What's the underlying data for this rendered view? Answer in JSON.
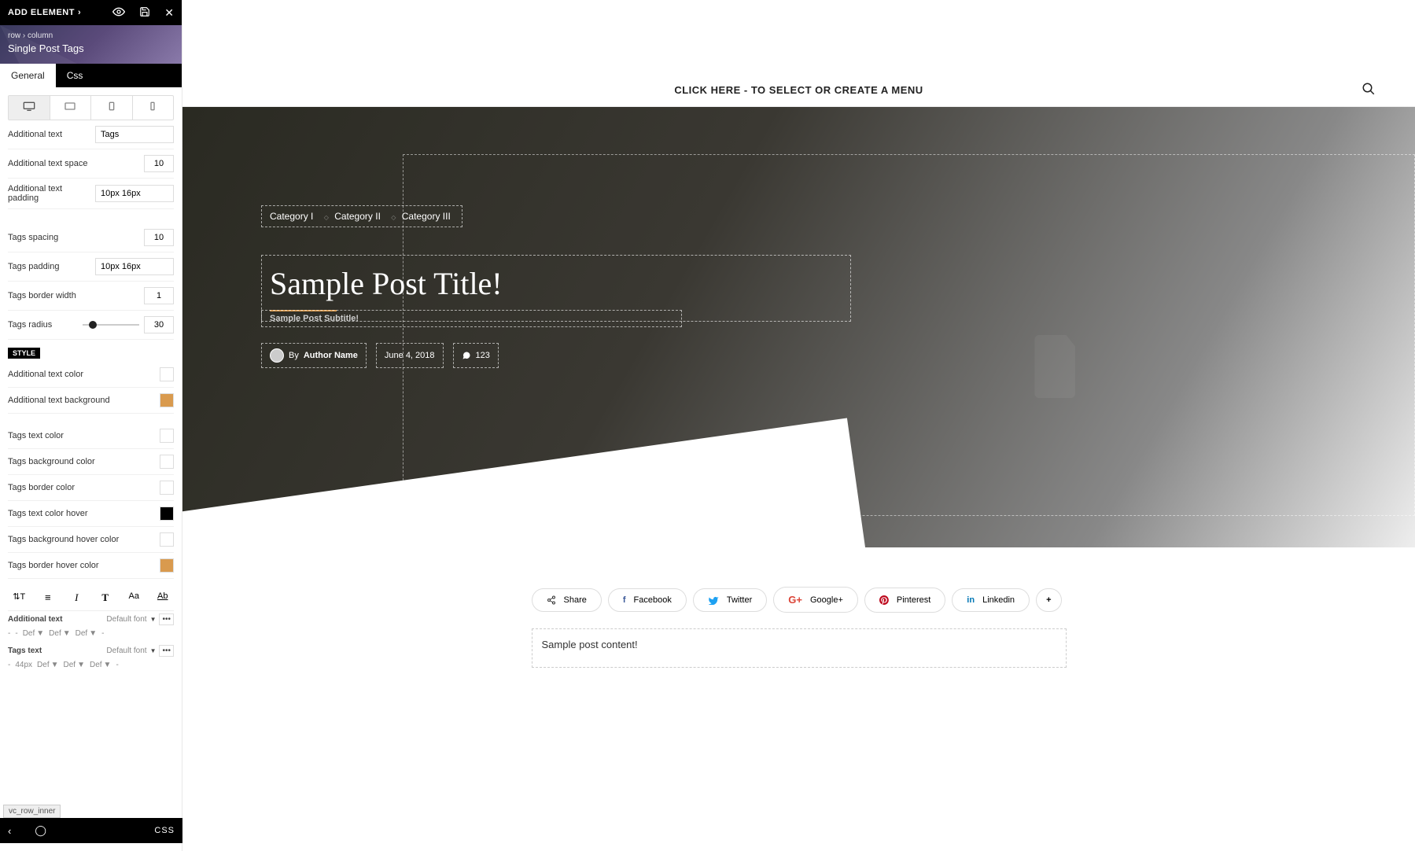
{
  "sidebar": {
    "add_element": "ADD ELEMENT",
    "breadcrumb": "row › column",
    "title": "Single Post Tags",
    "tabs": {
      "general": "General",
      "css": "Css"
    },
    "fields": {
      "additional_text": {
        "label": "Additional text",
        "value": "Tags"
      },
      "additional_text_space": {
        "label": "Additional text space",
        "value": "10"
      },
      "additional_text_padding": {
        "label": "Additional text padding",
        "value": "10px 16px"
      },
      "tags_spacing": {
        "label": "Tags spacing",
        "value": "10"
      },
      "tags_padding": {
        "label": "Tags padding",
        "value": "10px 16px"
      },
      "tags_border_width": {
        "label": "Tags border width",
        "value": "1"
      },
      "tags_radius": {
        "label": "Tags radius",
        "value": "30"
      }
    },
    "style_label": "STYLE",
    "colors": {
      "additional_text_color": "Additional text color",
      "additional_text_background": "Additional text background",
      "tags_text_color": "Tags text color",
      "tags_background_color": "Tags background color",
      "tags_border_color": "Tags border color",
      "tags_text_color_hover": "Tags text color hover",
      "tags_background_hover_color": "Tags background hover color",
      "tags_border_hover_color": "Tags border hover color"
    },
    "color_values": {
      "additional_text_background": "#d99a4e",
      "tags_text_color_hover": "#000000",
      "tags_border_hover_color": "#d99a4e"
    },
    "typo": {
      "additional_text_label": "Additional text",
      "tags_text_label": "Tags text",
      "default_font": "Default font",
      "def": "Def",
      "px44": "44px",
      "dash": "-"
    },
    "vc_row": "vc_row_inner",
    "bottom_css": "CSS"
  },
  "preview": {
    "menu_text": "CLICK HERE - TO SELECT OR CREATE A MENU",
    "categories": [
      "Category I",
      "Category II",
      "Category III"
    ],
    "post_title": "Sample Post Title!",
    "post_subtitle": "Sample Post Subtitle!",
    "by": "By",
    "author": "Author Name",
    "date": "June 4, 2018",
    "comments": "123",
    "share_label": "Share",
    "socials": {
      "facebook": "Facebook",
      "twitter": "Twitter",
      "google": "Google+",
      "pinterest": "Pinterest",
      "linkedin": "Linkedin"
    },
    "content": "Sample post content!"
  }
}
